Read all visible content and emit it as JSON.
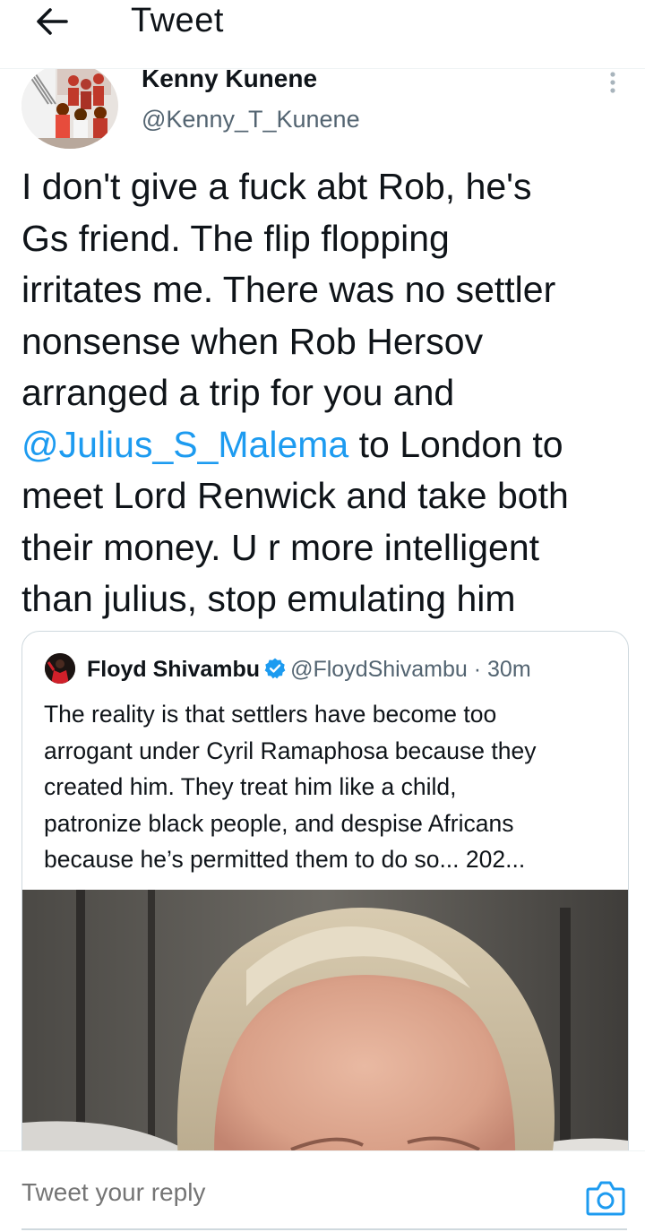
{
  "header": {
    "title": "Tweet",
    "back_icon": "arrow-left-icon"
  },
  "tweet": {
    "author_name": "Kenny Kunene",
    "author_handle": "@Kenny_T_Kunene",
    "more_icon": "more-vertical-icon",
    "text_lines": [
      "I don't give a fuck abt Rob, he's",
      "Gs friend. The flip flopping",
      "irritates me. There was no settler",
      "nonsense when Rob Hersov",
      "arranged a trip for you and",
      " to London to",
      "meet Lord Renwick and take both",
      "their money. U r more intelligent",
      "than julius, stop emulating him"
    ],
    "mention": "@Julius_S_Malema"
  },
  "quote": {
    "name": "Floyd Shivambu",
    "verified_icon": "verified-badge-icon",
    "handle": "@FloydShivambu",
    "separator": "·",
    "time": "30m",
    "text_lines": [
      "The reality is that settlers have become too",
      "arrogant under Cyril Ramaphosa because they",
      "created him. They treat him like a child,",
      "patronize black people, and despise Africans",
      "because he’s permitted them to do so... 202..."
    ]
  },
  "reply": {
    "placeholder": "Tweet your reply",
    "camera_icon": "camera-icon"
  },
  "colors": {
    "link": "#1d9bf0",
    "secondary_text": "#536471",
    "border": "#cfd9de",
    "primary_text": "#0f1419"
  }
}
